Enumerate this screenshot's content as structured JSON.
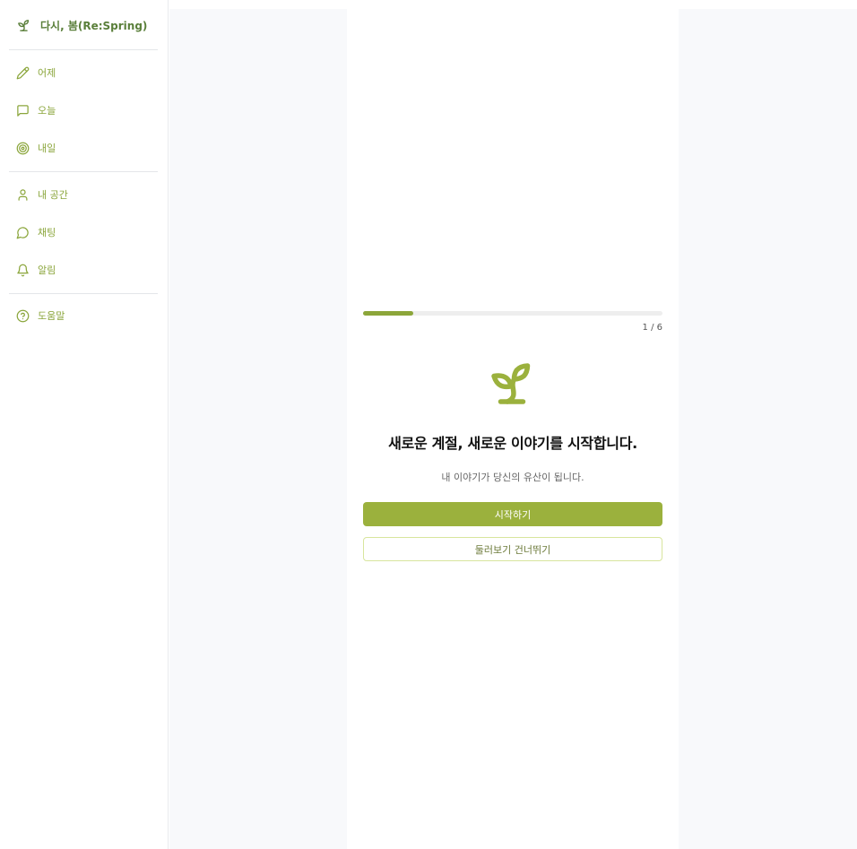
{
  "brand": {
    "name": "다시, 봄(Re:Spring)",
    "icon": "sprout-icon"
  },
  "sidebar": {
    "groups": [
      [
        {
          "label": "어제",
          "icon": "pencil-icon"
        },
        {
          "label": "오늘",
          "icon": "message-square-icon"
        },
        {
          "label": "내일",
          "icon": "target-icon"
        }
      ],
      [
        {
          "label": "내 공간",
          "icon": "user-icon"
        },
        {
          "label": "채팅",
          "icon": "message-circle-icon"
        },
        {
          "label": "알림",
          "icon": "bell-icon"
        }
      ],
      [
        {
          "label": "도움말",
          "icon": "help-circle-icon"
        }
      ]
    ]
  },
  "onboarding": {
    "progress": {
      "current": 1,
      "total": 6,
      "fraction": 0.1667,
      "label": "1 / 6"
    },
    "hero_icon": "sprout-icon",
    "title": "새로운 계절, 새로운 이야기를 시작합니다.",
    "subtitle": "내 이야기가 당신의 유산이 됩니다.",
    "primary_button": "시작하기",
    "secondary_button": "둘러보기 건너뛰기"
  },
  "colors": {
    "accent": "#9bb13d",
    "brand_text": "#5a7f3a",
    "nav_text": "#8ba63c",
    "skip_border": "#d8e59d",
    "main_bg": "#f8f9fb"
  }
}
